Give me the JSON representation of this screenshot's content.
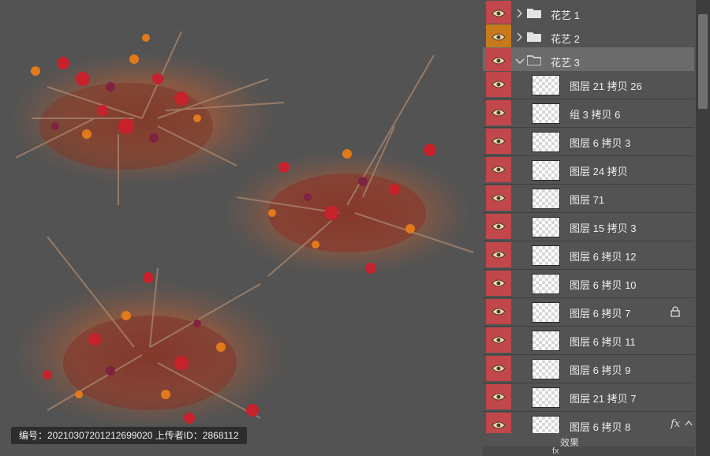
{
  "colors": {
    "eye_red": "#c0474b",
    "eye_orange": "#c77a1c",
    "canvas_bg": "#535353",
    "selected_row": "#6b6b6b"
  },
  "watermark": {
    "text": "编号：20210307201212699020 上传者ID：2868112"
  },
  "layers_panel": {
    "groups": [
      {
        "label": "花艺 1",
        "expanded": false,
        "eye_color": "red"
      },
      {
        "label": "花艺 2",
        "expanded": false,
        "eye_color": "orange"
      },
      {
        "label": "花艺 3",
        "expanded": true,
        "eye_color": "red",
        "selected": true
      }
    ],
    "layers": [
      {
        "label": "图层 21 拷贝 26"
      },
      {
        "label": "组 3 拷贝 6"
      },
      {
        "label": "图层 6 拷贝 3"
      },
      {
        "label": "图层 24 拷贝"
      },
      {
        "label": "图层 71"
      },
      {
        "label": "图层 15 拷贝 3"
      },
      {
        "label": "图层 6 拷贝 12"
      },
      {
        "label": "图层 6 拷贝 10"
      },
      {
        "label": "图层 6 拷贝 7",
        "locked": true
      },
      {
        "label": "图层 6 拷贝 11"
      },
      {
        "label": "图层 6 拷贝 9"
      },
      {
        "label": "图层 21 拷贝 7"
      },
      {
        "label": "图层 6 拷贝 8",
        "fx": "fx"
      }
    ],
    "effects_label": "效果",
    "bottom_fx": "fx"
  }
}
